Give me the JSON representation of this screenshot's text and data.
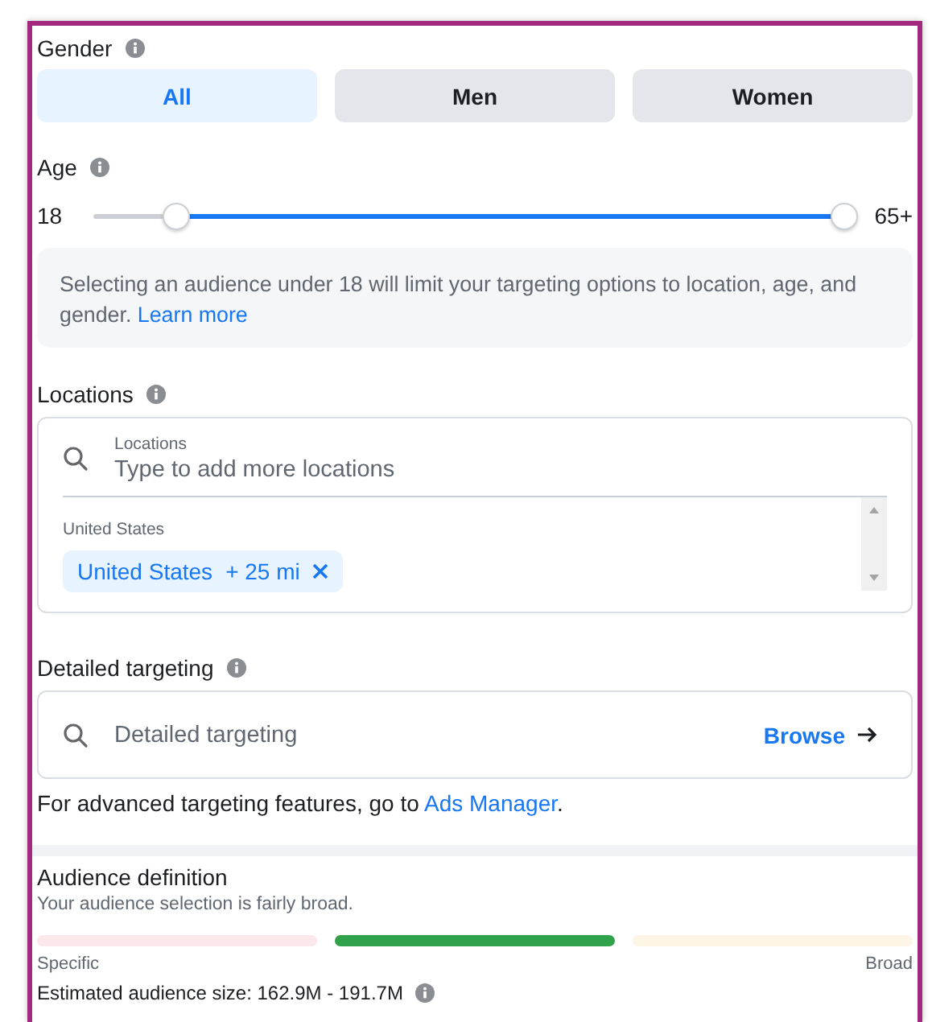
{
  "gender": {
    "label": "Gender",
    "options": [
      {
        "label": "All",
        "selected": true
      },
      {
        "label": "Men",
        "selected": false
      },
      {
        "label": "Women",
        "selected": false
      }
    ]
  },
  "age": {
    "label": "Age",
    "min_label": "18",
    "max_label": "65+",
    "thumbs": [
      {
        "level": 0.11
      },
      {
        "level": 1
      }
    ],
    "notice": "Selecting an audience under 18 will limit your targeting options to location, age, and gender.",
    "notice_link": "Learn more"
  },
  "locations": {
    "label": "Locations",
    "field_label": "Locations",
    "placeholder": "Type to add more locations",
    "group_label": "United States",
    "chips": [
      {
        "name": "United States",
        "radius": "+ 25 mi"
      }
    ]
  },
  "detailed_targeting": {
    "label": "Detailed targeting",
    "placeholder": "Detailed targeting",
    "browse": "Browse",
    "note": "For advanced targeting features, go to",
    "note_link": "Ads Manager",
    "note_end": "."
  },
  "audience_definition": {
    "title": "Audience definition",
    "subtitle": "Your audience selection is fairly broad.",
    "segments": [
      {
        "color": "#fce8ea"
      },
      {
        "color": "#31a24c"
      },
      {
        "color": "#fdf5e6"
      }
    ],
    "left_label": "Specific",
    "right_label": "Broad",
    "estimate": "Estimated audience size: 162.9M - 191.7M"
  }
}
